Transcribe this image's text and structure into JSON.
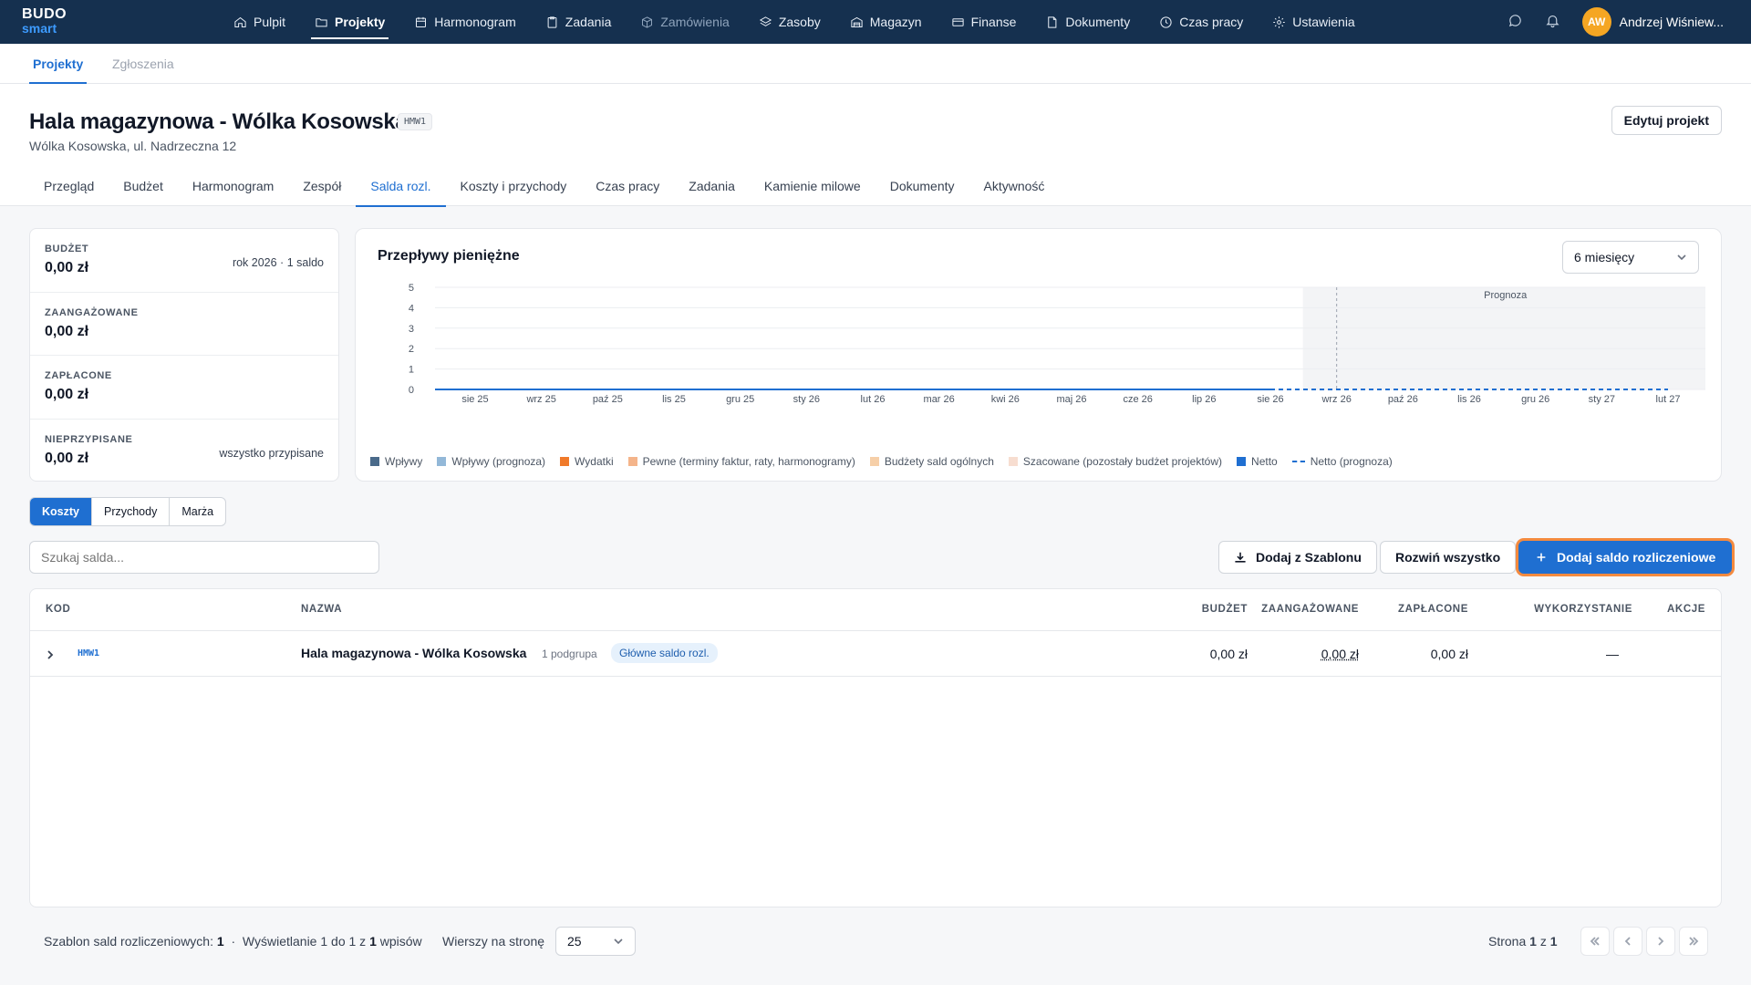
{
  "app": {
    "logo_top": "BUDO",
    "logo_bottom": "smart"
  },
  "nav": {
    "items": [
      {
        "label": "Pulpit",
        "icon": "home-icon"
      },
      {
        "label": "Projekty",
        "icon": "folder-icon"
      },
      {
        "label": "Harmonogram",
        "icon": "calendar-icon"
      },
      {
        "label": "Zadania",
        "icon": "clipboard-icon"
      },
      {
        "label": "Zamówienia",
        "icon": "box-icon"
      },
      {
        "label": "Zasoby",
        "icon": "layers-icon"
      },
      {
        "label": "Magazyn",
        "icon": "warehouse-icon"
      },
      {
        "label": "Finanse",
        "icon": "card-icon"
      },
      {
        "label": "Dokumenty",
        "icon": "document-icon"
      },
      {
        "label": "Czas pracy",
        "icon": "clock-icon"
      },
      {
        "label": "Ustawienia",
        "icon": "gear-icon"
      }
    ],
    "active": "Projekty",
    "user_initials": "AW",
    "user_name": "Andrzej Wiśniew..."
  },
  "subnav": {
    "tabs": [
      "Projekty",
      "Zgłoszenia"
    ],
    "active": "Projekty"
  },
  "project": {
    "title": "Hala magazynowa - Wólka Kosowska",
    "code": "HMW1",
    "address": "Wólka Kosowska, ul. Nadrzeczna 12",
    "edit_label": "Edytuj projekt",
    "tabs": [
      "Przegląd",
      "Budżet",
      "Harmonogram",
      "Zespół",
      "Salda rozl.",
      "Koszty i przychody",
      "Czas pracy",
      "Zadania",
      "Kamienie milowe",
      "Dokumenty",
      "Aktywność"
    ],
    "active_tab": "Salda rozl."
  },
  "summary": [
    {
      "label": "BUDŻET",
      "value": "0,00 zł",
      "note": "rok 2026 · 1 saldo"
    },
    {
      "label": "ZAANGAŻOWANE",
      "value": "0,00 zł",
      "note": ""
    },
    {
      "label": "ZAPŁACONE",
      "value": "0,00 zł",
      "note": ""
    },
    {
      "label": "NIEPRZYPISANE",
      "value": "0,00 zł",
      "note": "wszystko przypisane"
    }
  ],
  "chart": {
    "title": "Przepływy pieniężne",
    "range_label": "6 miesięcy",
    "forecast_label": "Prognoza",
    "legend": [
      {
        "label": "Wpływy",
        "color": "#4a6a8a",
        "style": "square"
      },
      {
        "label": "Wpływy (prognoza)",
        "color": "#93b8d8",
        "style": "square"
      },
      {
        "label": "Wydatki",
        "color": "#f07a2a",
        "style": "square"
      },
      {
        "label": "Pewne (terminy faktur, raty, harmonogramy)",
        "color": "#f4b48a",
        "style": "square"
      },
      {
        "label": "Budżety sald ogólnych",
        "color": "#f6cfa8",
        "style": "square"
      },
      {
        "label": "Szacowane (pozostały budżet projektów)",
        "color": "#f7ddd0",
        "style": "square"
      },
      {
        "label": "Netto",
        "color": "#1f6fd1",
        "style": "square"
      },
      {
        "label": "Netto (prognoza)",
        "color": "#1f6fd1",
        "style": "dash"
      }
    ]
  },
  "chart_data": {
    "type": "line",
    "title": "Przepływy pieniężne",
    "x": [
      "sie 25",
      "wrz 25",
      "paź 25",
      "lis 25",
      "gru 25",
      "sty 26",
      "lut 26",
      "mar 26",
      "kwi 26",
      "maj 26",
      "cze 26",
      "lip 26",
      "sie 26",
      "wrz 26",
      "paź 26",
      "lis 26",
      "gru 26",
      "sty 27",
      "lut 27"
    ],
    "yticks": [
      0,
      1,
      2,
      3,
      4,
      5
    ],
    "ylim": [
      0,
      5
    ],
    "forecast_start": "wrz 26",
    "series": [
      {
        "name": "Netto",
        "values": [
          0,
          0,
          0,
          0,
          0,
          0,
          0,
          0,
          0,
          0,
          0,
          0,
          0,
          null,
          null,
          null,
          null,
          null,
          null
        ]
      },
      {
        "name": "Netto (prognoza)",
        "values": [
          null,
          null,
          null,
          null,
          null,
          null,
          null,
          null,
          null,
          null,
          null,
          null,
          0,
          0,
          0,
          0,
          0,
          0,
          0
        ]
      }
    ]
  },
  "tabs": {
    "items": [
      "Koszty",
      "Przychody",
      "Marża"
    ],
    "active": "Koszty"
  },
  "toolbar": {
    "search_placeholder": "Szukaj salda...",
    "template_label": "Dodaj z Szablonu",
    "expand_label": "Rozwiń wszystko",
    "add_label": "Dodaj saldo rozliczeniowe"
  },
  "table": {
    "headers": {
      "code": "KOD",
      "name": "NAZWA",
      "budget": "BUDŻET",
      "committed": "ZAANGAŻOWANE",
      "paid": "ZAPŁACONE",
      "usage": "WYKORZYSTANIE",
      "actions": "AKCJE"
    },
    "rows": [
      {
        "code": "HMW1",
        "name": "Hala magazynowa - Wólka Kosowska",
        "sub": "1 podgrupa",
        "badge": "Główne saldo rozl.",
        "budget": "0,00 zł",
        "committed": "0,00 zł",
        "paid": "0,00 zł",
        "usage": "—"
      }
    ]
  },
  "footer": {
    "templates_text": "Szablon sald rozliczeniowych:",
    "templates_count": "1",
    "sep": "·",
    "showing_text": "Wyświetlanie 1 do 1 z",
    "showing_total": "1",
    "showing_suffix": "wpisów",
    "rows_label": "Wierszy na stronę",
    "rows_value": "25",
    "page_text": "Strona",
    "page_current": "1",
    "page_of": "z",
    "page_total": "1"
  }
}
